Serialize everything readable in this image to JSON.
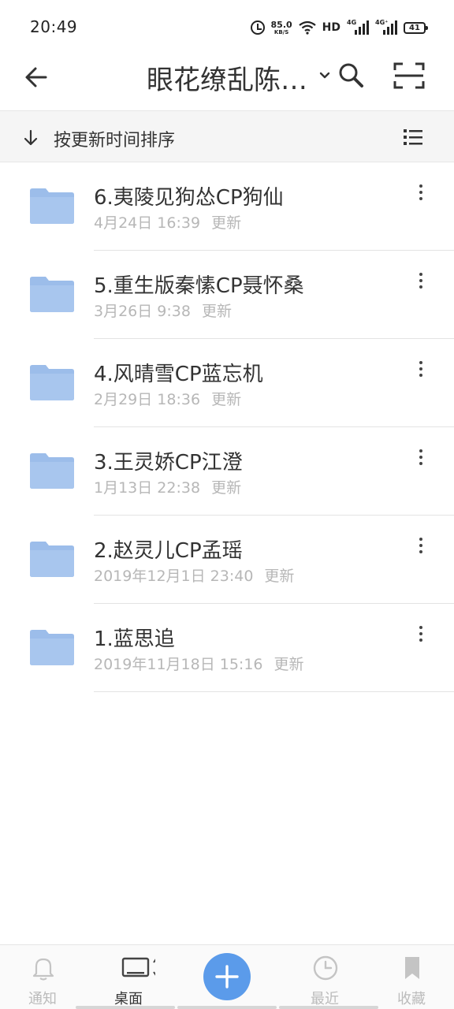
{
  "status_bar": {
    "time": "20:49",
    "speed_value": "85.0",
    "speed_unit": "KB/S",
    "hd_label": "HD",
    "sig1_label": "4G",
    "sig2_label": "4G⁺",
    "battery": "41"
  },
  "header": {
    "title": "眼花缭乱陈…",
    "icons": [
      "back-arrow-icon",
      "chevron-down-icon",
      "search-icon",
      "scan-icon"
    ]
  },
  "sort_bar": {
    "label": "按更新时间排序",
    "icons": [
      "arrow-down-icon",
      "list-view-icon"
    ]
  },
  "items": [
    {
      "name": "6.夷陵见狗怂CP狗仙",
      "date": "4月24日 16:39",
      "status": "更新"
    },
    {
      "name": "5.重生版秦愫CP聂怀桑",
      "date": "3月26日 9:38",
      "status": "更新"
    },
    {
      "name": "4.风晴雪CP蓝忘机",
      "date": "2月29日 18:36",
      "status": "更新"
    },
    {
      "name": "3.王灵娇CP江澄",
      "date": "1月13日 22:38",
      "status": "更新"
    },
    {
      "name": "2.赵灵儿CP孟瑶",
      "date": "2019年12月1日 23:40",
      "status": "更新"
    },
    {
      "name": "1.蓝思追",
      "date": "2019年11月18日 15:16",
      "status": "更新"
    }
  ],
  "bottom_nav": {
    "notify": "通知",
    "desktop": "桌面",
    "recent": "最近",
    "favorites": "收藏"
  },
  "colors": {
    "accent": "#5b9bea",
    "folder": "#9cbdea",
    "meta_text": "#b7b7b7"
  }
}
